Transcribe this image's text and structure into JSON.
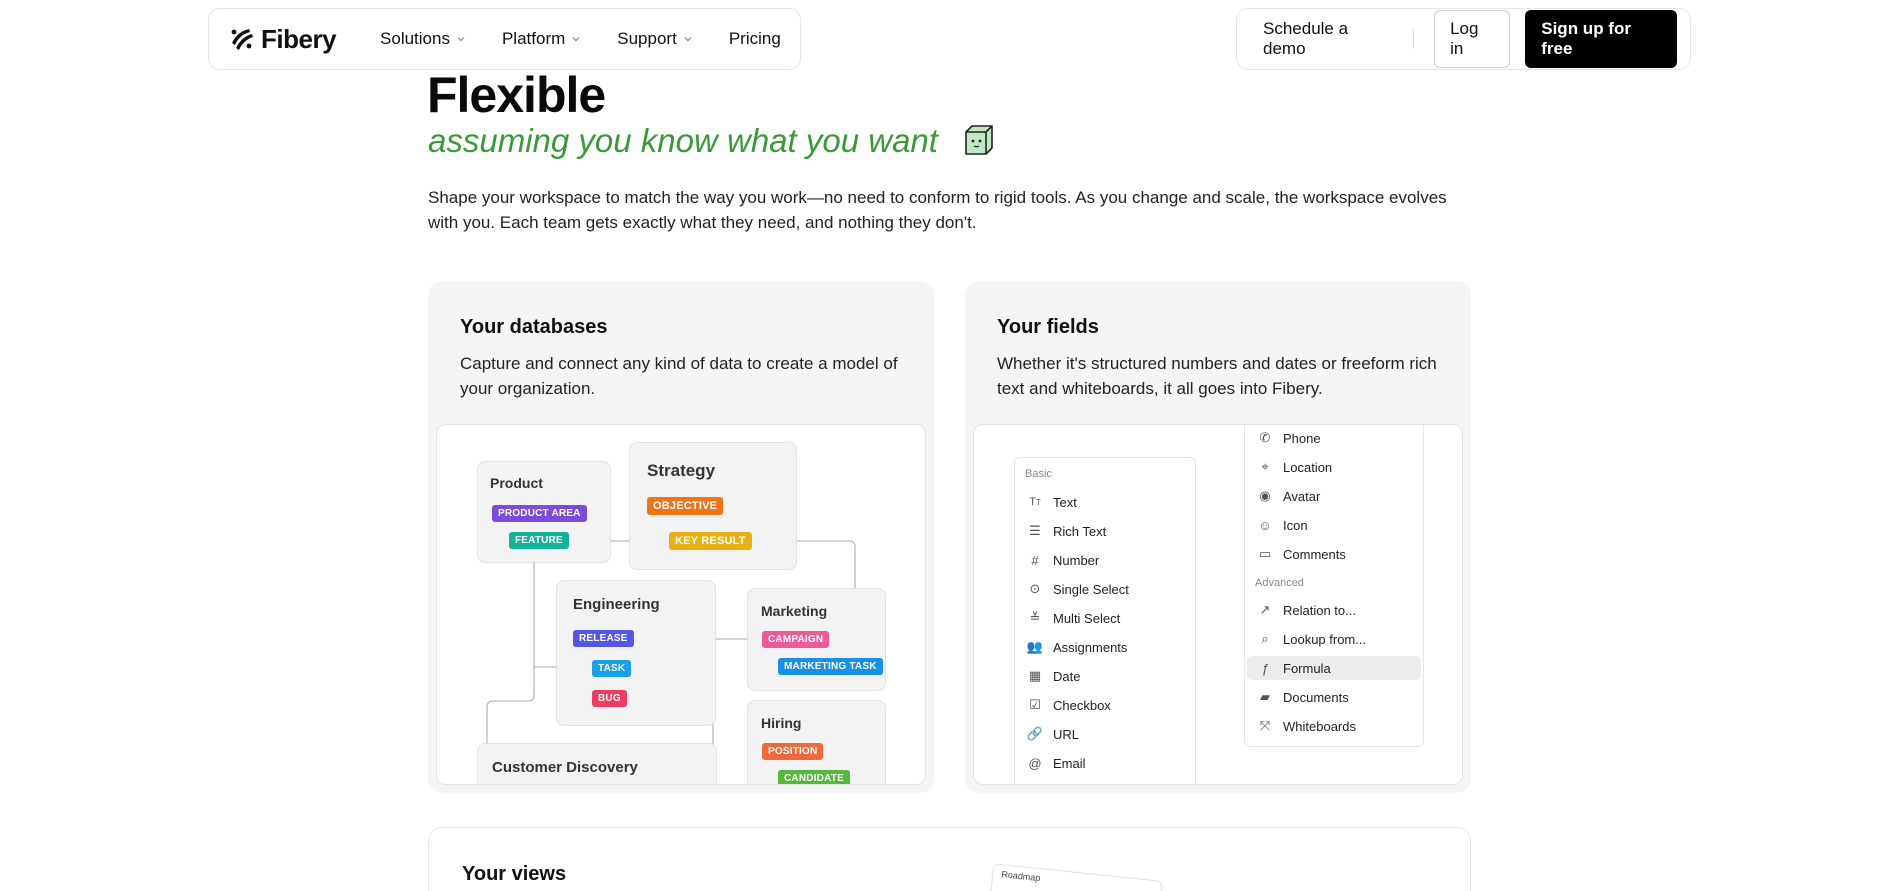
{
  "nav": {
    "logo_text": "Fibery",
    "items": [
      {
        "label": "Solutions",
        "has_dropdown": true
      },
      {
        "label": "Platform",
        "has_dropdown": true
      },
      {
        "label": "Support",
        "has_dropdown": true
      },
      {
        "label": "Pricing",
        "has_dropdown": false
      }
    ],
    "schedule_demo": "Schedule a demo",
    "log_in": "Log in",
    "sign_up": "Sign up for free"
  },
  "hero": {
    "title": "Flexible",
    "subtitle": "assuming you know what you want",
    "description": "Shape your workspace to match the way you work—no need to conform to rigid tools. As you change and scale, the workspace evolves with you. Each team gets exactly what they need, and nothing they don't."
  },
  "databases_card": {
    "title": "Your databases",
    "description": "Capture and connect any kind of data to create a model of your organization.",
    "groups": {
      "product": {
        "label": "Product",
        "tags": [
          "PRODUCT AREA",
          "FEATURE"
        ]
      },
      "strategy": {
        "label": "Strategy",
        "tags": [
          "OBJECTIVE",
          "KEY RESULT"
        ]
      },
      "engineering": {
        "label": "Engineering",
        "tags": [
          "RELEASE",
          "TASK",
          "BUG"
        ]
      },
      "marketing": {
        "label": "Marketing",
        "tags": [
          "CAMPAIGN",
          "MARKETING TASK"
        ]
      },
      "hiring": {
        "label": "Hiring",
        "tags": [
          "POSITION",
          "CANDIDATE"
        ]
      },
      "customer": {
        "label": "Customer Discovery"
      }
    },
    "tag_colors": {
      "PRODUCT AREA": "#7b4cdb",
      "FEATURE": "#12b39a",
      "OBJECTIVE": "#f07318",
      "KEY RESULT": "#e8b015",
      "RELEASE": "#5457e6",
      "TASK": "#1aa0e8",
      "BUG": "#ec3e62",
      "CAMPAIGN": "#ec5a99",
      "MARKETING TASK": "#1a8fe8",
      "POSITION": "#ee6a3a",
      "CANDIDATE": "#54b83a"
    }
  },
  "fields_card": {
    "title": "Your fields",
    "description": "Whether it's structured numbers and dates or freeform rich text and whiteboards, it all goes into Fibery.",
    "basic_heading": "Basic",
    "basic": [
      {
        "label": "Text",
        "icon": "text-icon"
      },
      {
        "label": "Rich Text",
        "icon": "rich-text-icon"
      },
      {
        "label": "Number",
        "icon": "hash-icon"
      },
      {
        "label": "Single Select",
        "icon": "single-select-icon"
      },
      {
        "label": "Multi Select",
        "icon": "multi-select-icon"
      },
      {
        "label": "Assignments",
        "icon": "users-icon"
      },
      {
        "label": "Date",
        "icon": "calendar-icon"
      },
      {
        "label": "Checkbox",
        "icon": "checkbox-icon"
      },
      {
        "label": "URL",
        "icon": "link-icon"
      },
      {
        "label": "Email",
        "icon": "at-icon"
      }
    ],
    "more": [
      {
        "label": "Phone",
        "icon": "phone-icon"
      },
      {
        "label": "Location",
        "icon": "location-icon"
      },
      {
        "label": "Avatar",
        "icon": "avatar-icon"
      },
      {
        "label": "Icon",
        "icon": "smile-icon"
      },
      {
        "label": "Comments",
        "icon": "comments-icon"
      }
    ],
    "advanced_heading": "Advanced",
    "advanced": [
      {
        "label": "Relation to...",
        "icon": "relation-icon"
      },
      {
        "label": "Lookup from...",
        "icon": "lookup-icon"
      },
      {
        "label": "Formula",
        "icon": "formula-icon",
        "active": true
      },
      {
        "label": "Documents",
        "icon": "documents-icon"
      },
      {
        "label": "Whiteboards",
        "icon": "whiteboard-icon"
      }
    ]
  },
  "views_card": {
    "title": "Your views",
    "roadmap_label": "Roadmap"
  },
  "colors": {
    "accent_green": "#3a9a3a",
    "signup_bg": "#000000"
  }
}
